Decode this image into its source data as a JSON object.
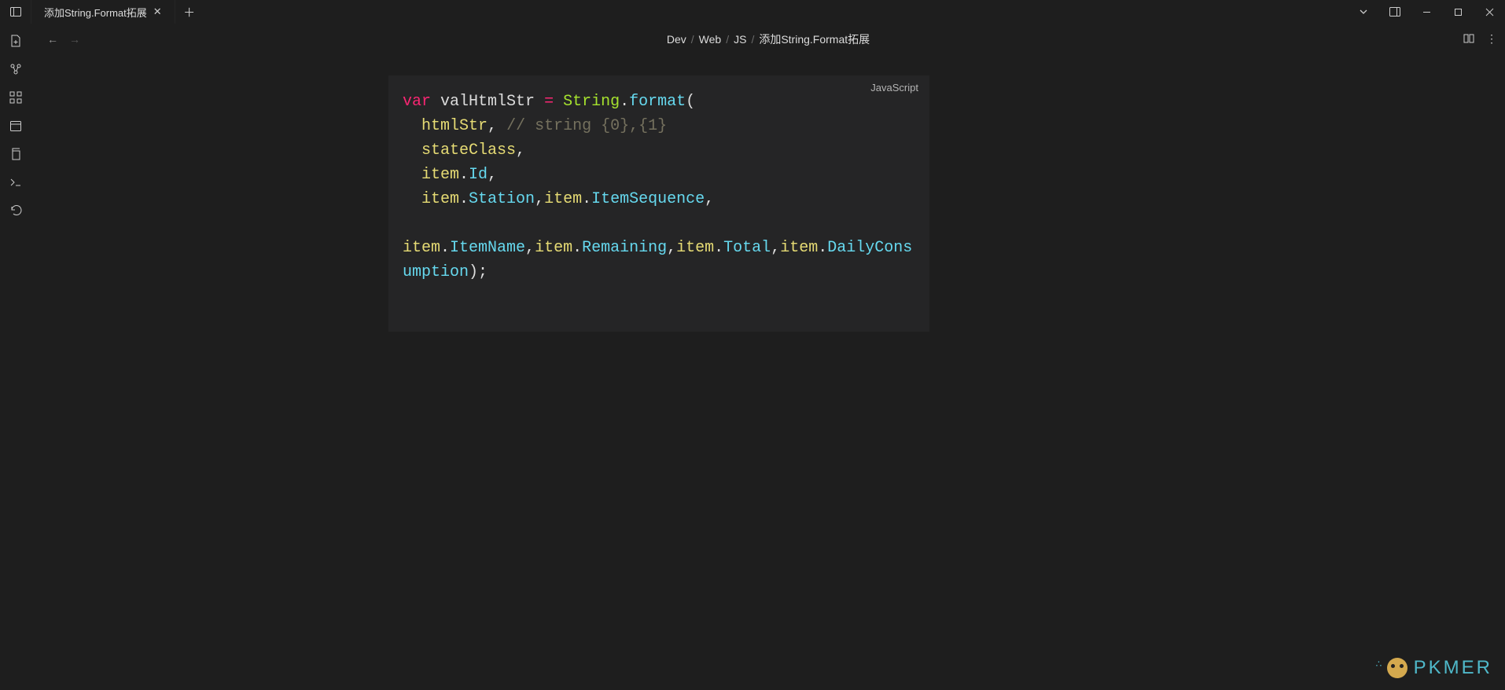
{
  "tab": {
    "title": "添加String.Format拓展"
  },
  "breadcrumb": {
    "p1": "Dev",
    "p2": "Web",
    "p3": "JS",
    "p4": "添加String.Format拓展"
  },
  "codeLang": "JavaScript",
  "code": {
    "kw_var": "var",
    "varname": "valHtmlStr",
    "eq": "=",
    "String": "String",
    "format": "format",
    "htmlStr": "htmlStr",
    "comment": "// string {0},{1}",
    "stateClass": "stateClass",
    "item": "item",
    "Id": "Id",
    "Station": "Station",
    "ItemSequence": "ItemSequence",
    "ItemName": "ItemName",
    "Remaining": "Remaining",
    "Total": "Total",
    "DailyConsumption": "DailyConsumption"
  },
  "watermark": "PKMER"
}
